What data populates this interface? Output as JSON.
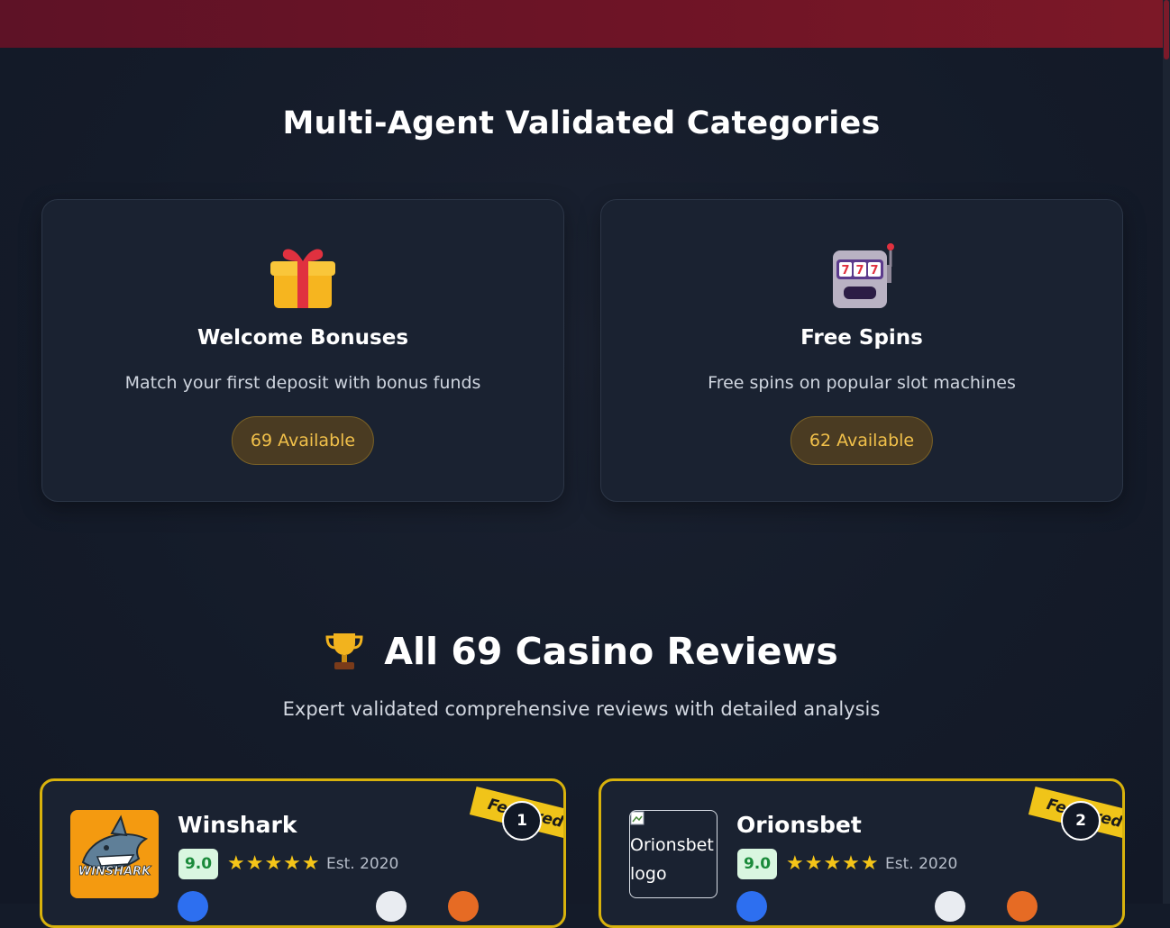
{
  "categories_section": {
    "title": "Multi-Agent Validated Categories",
    "cards": [
      {
        "icon": "gift-icon",
        "name": "Welcome Bonuses",
        "description": "Match your first deposit with bonus funds",
        "count_label": "69 Available"
      },
      {
        "icon": "slot-machine-icon",
        "name": "Free Spins",
        "description": "Free spins on popular slot machines",
        "count_label": "62 Available"
      }
    ]
  },
  "reviews_section": {
    "icon": "trophy-icon",
    "title": "All 69 Casino Reviews",
    "subtitle": "Expert validated comprehensive reviews with detailed analysis",
    "cards": [
      {
        "rank": "1",
        "ribbon": "Featured",
        "name": "Winshark",
        "logo_text": "WINSHARK",
        "score": "9.0",
        "stars": "★★★★★",
        "established": "Est. 2020"
      },
      {
        "rank": "2",
        "ribbon": "Featured",
        "name": "Orionsbet",
        "logo_alt": "Orionsbet logo",
        "score": "9.0",
        "stars": "★★★★★",
        "established": "Est. 2020"
      }
    ]
  },
  "colors": {
    "header_bar": "#6e1426",
    "background": "#141b29",
    "accent_gold": "#f1c04a",
    "featured_border": "#d8b20c",
    "score_green": "#1a8a3a"
  }
}
